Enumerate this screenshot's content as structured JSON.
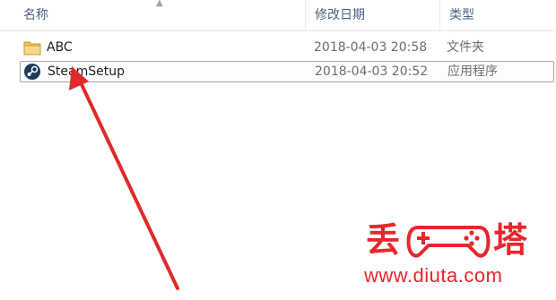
{
  "columns": {
    "name": "名称",
    "date_modified": "修改日期",
    "type": "类型"
  },
  "files": [
    {
      "name": "ABC",
      "date_modified": "2018-04-03 20:58",
      "type": "文件夹",
      "icon": "folder-icon"
    },
    {
      "name": "SteamSetup",
      "date_modified": "2018-04-03 20:52",
      "type": "应用程序",
      "icon": "steam-icon",
      "selected": true
    }
  ],
  "watermark": {
    "char_left": "丢",
    "char_right": "塔",
    "url": "www.diuta.com",
    "color": "#e8262b"
  },
  "annotation": {
    "color": "#e02a2a",
    "type": "arrow"
  }
}
